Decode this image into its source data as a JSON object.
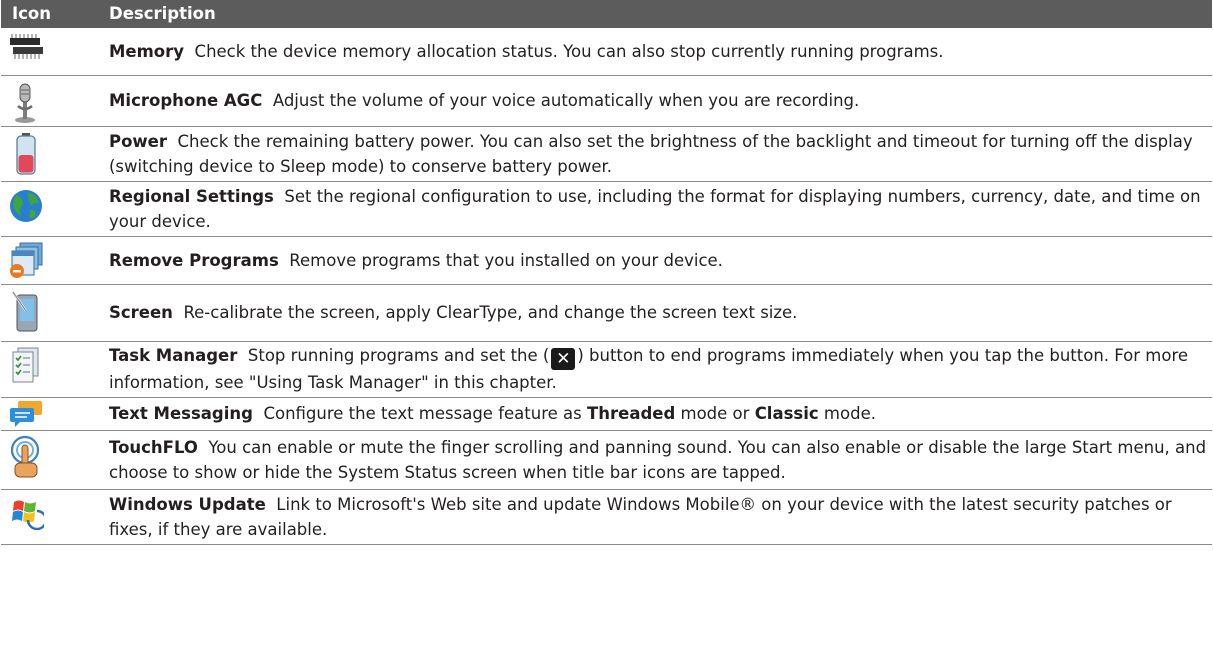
{
  "table": {
    "header": {
      "icon": "Icon",
      "description": "Description"
    },
    "rows": [
      {
        "icon": "memory-chip-icon",
        "term": "Memory",
        "text": "Check the device memory allocation status. You can also stop currently running programs."
      },
      {
        "icon": "microphone-icon",
        "term": "Microphone AGC",
        "text": "Adjust the volume of your voice automatically when you are recording."
      },
      {
        "icon": "battery-icon",
        "term": "Power",
        "text": "Check the remaining battery power. You can also set the brightness of the backlight and timeout for turning off the display (switching device to Sleep mode) to conserve battery power."
      },
      {
        "icon": "globe-icon",
        "term": "Regional Settings",
        "text": "Set the regional configuration to use, including the format for displaying numbers, currency, date, and time on your device."
      },
      {
        "icon": "remove-programs-icon",
        "term": "Remove Programs",
        "text": "Remove programs that you installed on your device."
      },
      {
        "icon": "screen-device-icon",
        "term": "Screen",
        "text": "Re-calibrate the screen, apply ClearType, and change the screen text size."
      },
      {
        "icon": "task-manager-icon",
        "term": "Task Manager",
        "text_before": "Stop running programs and set the (",
        "button_glyph": "✕",
        "text_after": ") button to end programs immediately when you tap the button. For more information, see \"Using Task Manager\" in this chapter."
      },
      {
        "icon": "text-messaging-icon",
        "term": "Text Messaging",
        "text_1": "Configure the text message feature as",
        "bold_1": "Threaded",
        "text_2": "mode or",
        "bold_2": "Classic",
        "text_3": "mode."
      },
      {
        "icon": "touchflo-icon",
        "term": "TouchFLO",
        "text": "You can enable or mute the finger scrolling and panning sound. You can also enable or disable the large Start menu, and choose to show or hide the System Status screen when title bar icons are tapped."
      },
      {
        "icon": "windows-update-icon",
        "term": "Windows Update",
        "text": "Link to Microsoft's Web site and update Windows Mobile® on your device with the latest security patches or fixes, if they are available."
      }
    ]
  }
}
